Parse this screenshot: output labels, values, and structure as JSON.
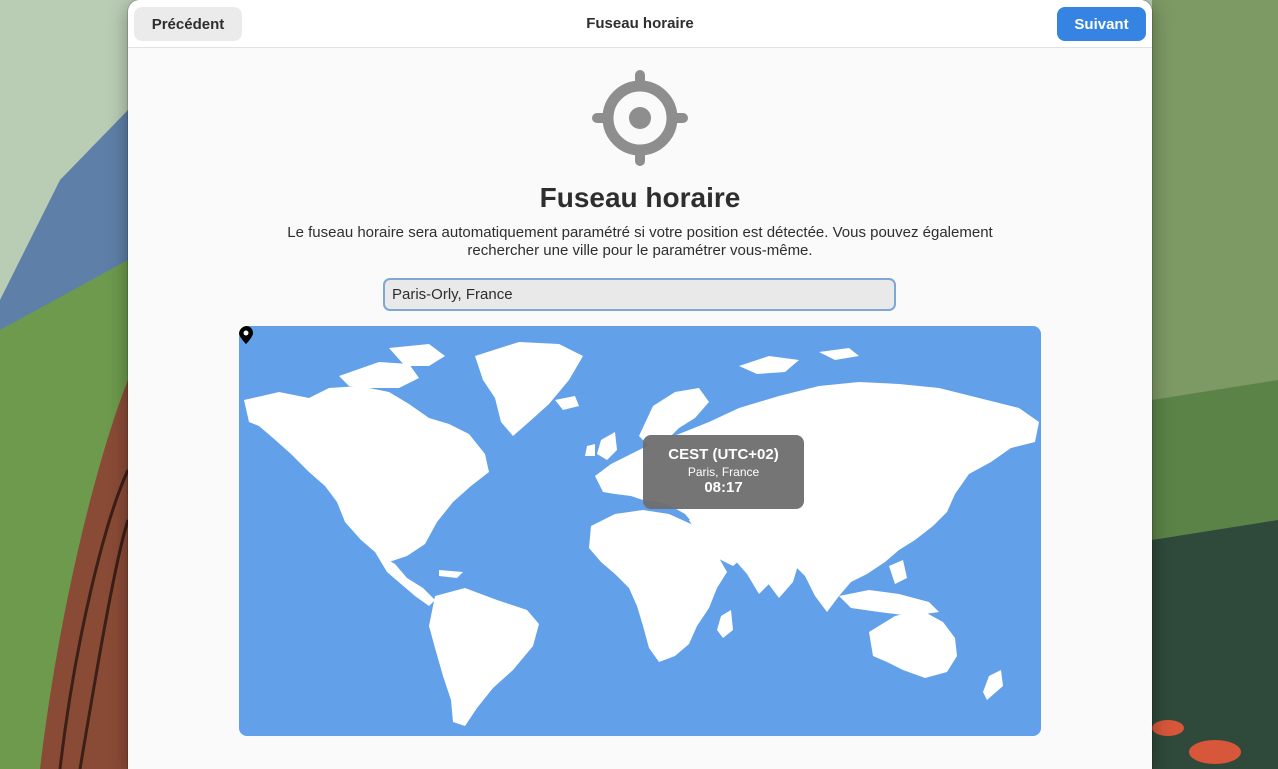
{
  "header": {
    "title": "Fuseau horaire",
    "back_label": "Précédent",
    "next_label": "Suivant"
  },
  "page": {
    "icon": "location-crosshair-icon",
    "title": "Fuseau horaire",
    "description": "Le fuseau horaire sera automatiquement paramétré si votre position est détectée. Vous pouvez également rechercher une ville pour le paramétrer vous-même."
  },
  "search": {
    "value": "Paris-Orly, France"
  },
  "map": {
    "pin_icon": "map-pin-icon",
    "tooltip": {
      "timezone": "CEST (UTC+02)",
      "city": "Paris, France",
      "time": "08:17"
    }
  },
  "colors": {
    "accent": "#3584e4",
    "ocean": "#62a0ea",
    "land": "#ffffff"
  }
}
